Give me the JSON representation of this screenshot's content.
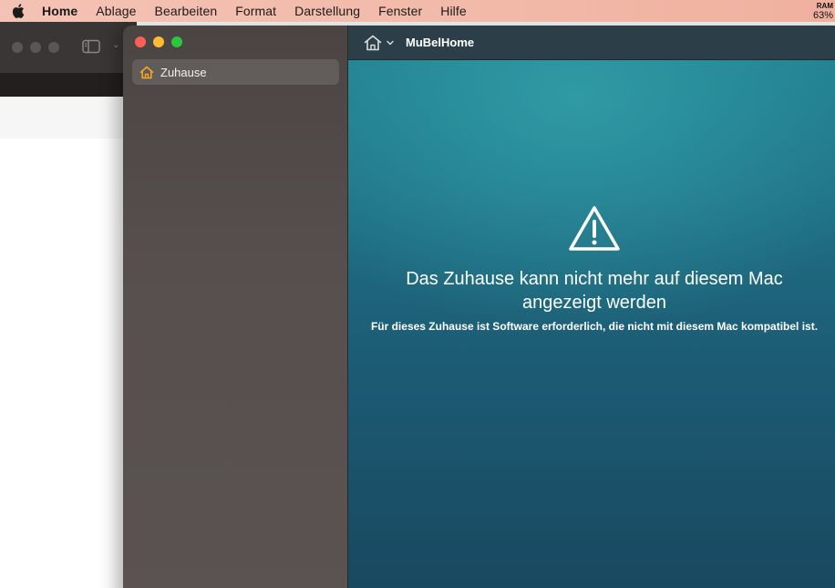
{
  "menubar": {
    "app_name": "Home",
    "items": [
      "Ablage",
      "Bearbeiten",
      "Format",
      "Darstellung",
      "Fenster",
      "Hilfe"
    ],
    "ram_label": "RAM",
    "ram_value": "63%"
  },
  "sidebar": {
    "items": [
      {
        "label": "Zuhause",
        "icon": "house-icon",
        "icon_color": "#f5a623",
        "selected": true
      }
    ]
  },
  "toolbar": {
    "home_icon": "house-icon",
    "title": "MuBelHome"
  },
  "message": {
    "icon": "warning-triangle-icon",
    "title": "Das Zuhause kann nicht mehr auf diesem Mac angezeigt werden",
    "subtitle": "Für dieses Zuhause ist Software erforderlich, die nicht mit diesem Mac kompatibel ist."
  },
  "colors": {
    "close": "#fe5f57",
    "minimize": "#febc2e",
    "maximize": "#28c840"
  }
}
